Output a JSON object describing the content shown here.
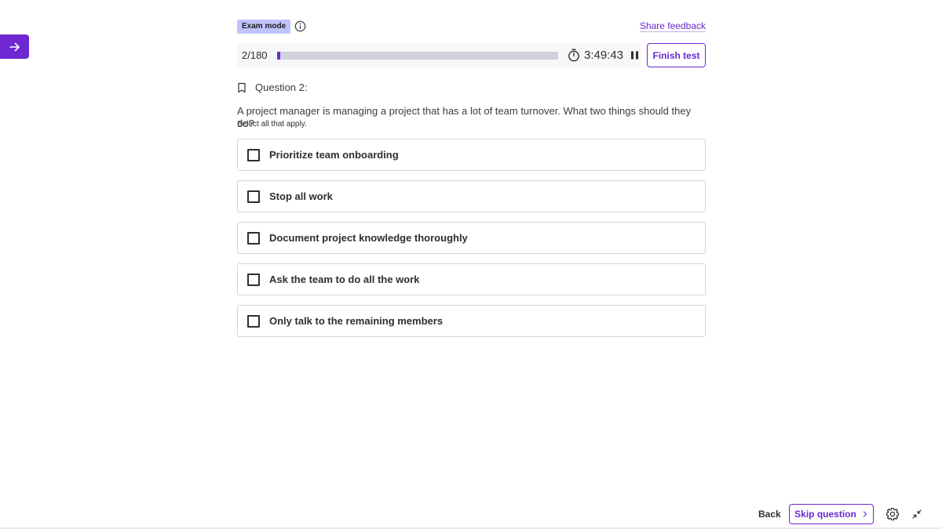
{
  "header": {
    "badge": "Exam mode",
    "share_feedback": "Share feedback"
  },
  "progress": {
    "counter": "2/180",
    "fraction": 0.011,
    "timer": "3:49:43"
  },
  "actions": {
    "finish": "Finish test",
    "back": "Back",
    "skip": "Skip question"
  },
  "question": {
    "title": "Question 2:",
    "text": "A project manager is managing a project that has a lot of team turnover. What two things should they do?",
    "hint": "Select all that apply.",
    "options": [
      {
        "label": "Prioritize team onboarding",
        "checked": false
      },
      {
        "label": "Stop all work",
        "checked": false
      },
      {
        "label": "Document project knowledge thoroughly",
        "checked": false
      },
      {
        "label": "Ask the team to do all the work",
        "checked": false
      },
      {
        "label": "Only talk to the remaining members",
        "checked": false
      }
    ]
  },
  "colors": {
    "accent": "#6d28d2",
    "badge_bg": "#c0c4fc",
    "border": "#d1d2e0"
  },
  "icons": {
    "sidebar_toggle": "arrow-right-icon",
    "info": "info-icon",
    "timer": "stopwatch-icon",
    "pause": "pause-icon",
    "bookmark": "bookmark-icon",
    "skip_chevron": "chevron-right-icon",
    "settings": "gear-icon",
    "collapse": "collapse-icon"
  }
}
